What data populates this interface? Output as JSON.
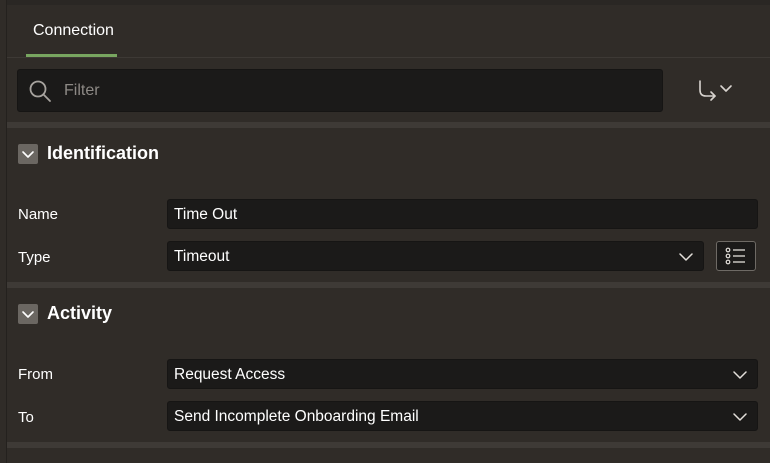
{
  "tabs": [
    {
      "label": "Connection",
      "active": true
    }
  ],
  "filter": {
    "placeholder": "Filter",
    "value": ""
  },
  "sections": {
    "identification": {
      "title": "Identification",
      "fields": {
        "name": {
          "label": "Name",
          "value": "Time Out"
        },
        "type": {
          "label": "Type",
          "value": "Timeout"
        }
      }
    },
    "activity": {
      "title": "Activity",
      "fields": {
        "from": {
          "label": "From",
          "value": "Request Access"
        },
        "to": {
          "label": "To",
          "value": "Send Incomplete Onboarding Email"
        }
      }
    }
  },
  "icons": {
    "search": "search-icon",
    "goto": "goto-arrow-icon",
    "chevron": "chevron-down-icon",
    "list": "list-icon"
  },
  "colors": {
    "background": "#302c28",
    "field_bg": "#1b1a19",
    "accent_tab": "#78a660",
    "divider": "#3e3a36"
  }
}
